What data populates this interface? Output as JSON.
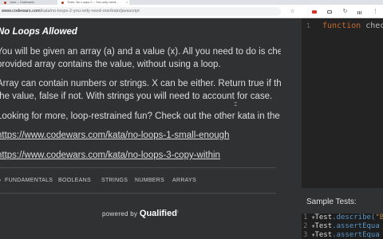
{
  "browser": {
    "tabs": [
      {
        "label": "Joke – Codewars"
      },
      {
        "label": "Train: No Loops 2 – You only need..."
      }
    ],
    "url_domain": "www.codewars.com",
    "url_path": "/kata/no-loops-2-you-only-need-one/train/javascript",
    "icons": [
      "star-icon",
      "extension-icon",
      "window-icon",
      "refresh-icon",
      "menu-icon",
      "more-icon"
    ]
  },
  "description": {
    "title": "No Loops Allowed",
    "paragraph1": [
      "You will be given an array (a) and a value (x). All you need to do is check whether the",
      "provided array contains the value, without using a loop."
    ],
    "paragraph2": [
      "Array can contain numbers or strings. X can be either. Return true if the array contains",
      "the value, false if not. With strings you will need to account for case."
    ],
    "paragraph3": "Looking for more, loop-restrained fun? Check out the other kata in the series:",
    "links": [
      "https://www.codewars.com/kata/no-loops-1-small-enough",
      "https://www.codewars.com/kata/no-loops-3-copy-within"
    ],
    "tags": [
      "FUNDAMENTALS",
      "BOOLEANS",
      "STRINGS",
      "NUMBERS",
      "ARRAYS"
    ],
    "powered_prefix": "powered by",
    "powered_brand": "Qualified"
  },
  "editor": {
    "line_number": "1",
    "keyword": "function",
    "function_fragment": "check(a"
  },
  "sample_tests": {
    "label": "Sample Tests:",
    "lines": [
      {
        "num": "1",
        "obj": "Test",
        "method": ".describe(",
        "arg": "\"B"
      },
      {
        "num": "2",
        "obj": "Test",
        "method": ".assertEqua",
        "arg": ""
      },
      {
        "num": "3",
        "obj": "Test",
        "method": ".assertEqua",
        "arg": ""
      }
    ]
  },
  "colors": {
    "panel_bg": "#303133",
    "editor_bg": "#232323",
    "keyword": "#c76b2f",
    "method": "#5a95c6"
  }
}
